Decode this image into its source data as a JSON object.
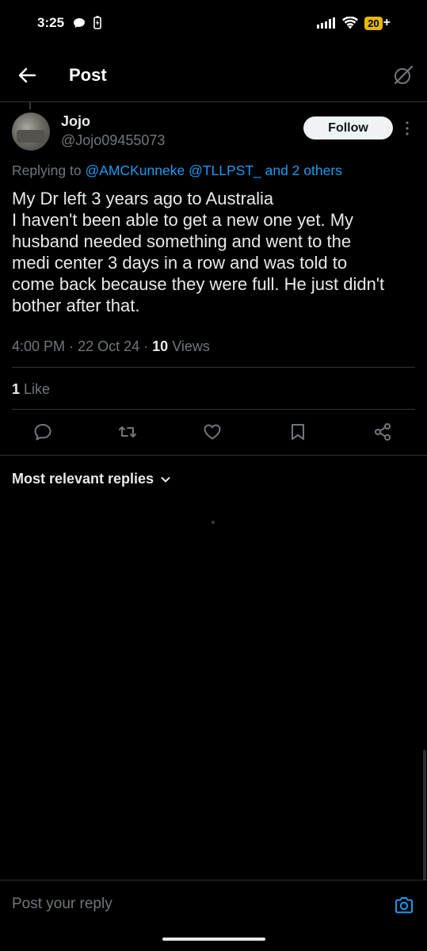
{
  "status_bar": {
    "time": "3:25",
    "battery": "20",
    "battery_suffix": "+",
    "battery_color": "#e5b800"
  },
  "header": {
    "title": "Post",
    "back_icon": "arrow-left-icon",
    "grok_icon": "grok-icon"
  },
  "post": {
    "author": {
      "name": "Jojo",
      "handle": "@Jojo09455073"
    },
    "follow_label": "Follow",
    "replying": {
      "prefix": "Replying to",
      "mention_1": "@AMCKunneke",
      "mention_2": "@TLLPST_",
      "others": "and 2 others"
    },
    "body_lines": [
      "My Dr left 3 years ago to Australia",
      "I haven't been able to get a new one yet. My",
      "husband needed something and went to the",
      "medi center 3 days in a row and was told to",
      "come back because they were full. He just didn't",
      "bother after that."
    ],
    "time": "4:00 PM",
    "date": "22 Oct 24",
    "views_count": "10",
    "views_label": "Views",
    "likes_count": "1",
    "likes_label": "Like",
    "separator": "·"
  },
  "actions": [
    {
      "name": "reply-icon"
    },
    {
      "name": "repost-icon"
    },
    {
      "name": "like-icon"
    },
    {
      "name": "bookmark-icon"
    },
    {
      "name": "share-icon"
    }
  ],
  "replies": {
    "sort_label": "Most relevant replies"
  },
  "composer": {
    "placeholder": "Post your reply"
  },
  "colors": {
    "accent": "#1d9bf0",
    "background": "#000000",
    "text": "#e7e9ea",
    "muted": "#71767b"
  }
}
